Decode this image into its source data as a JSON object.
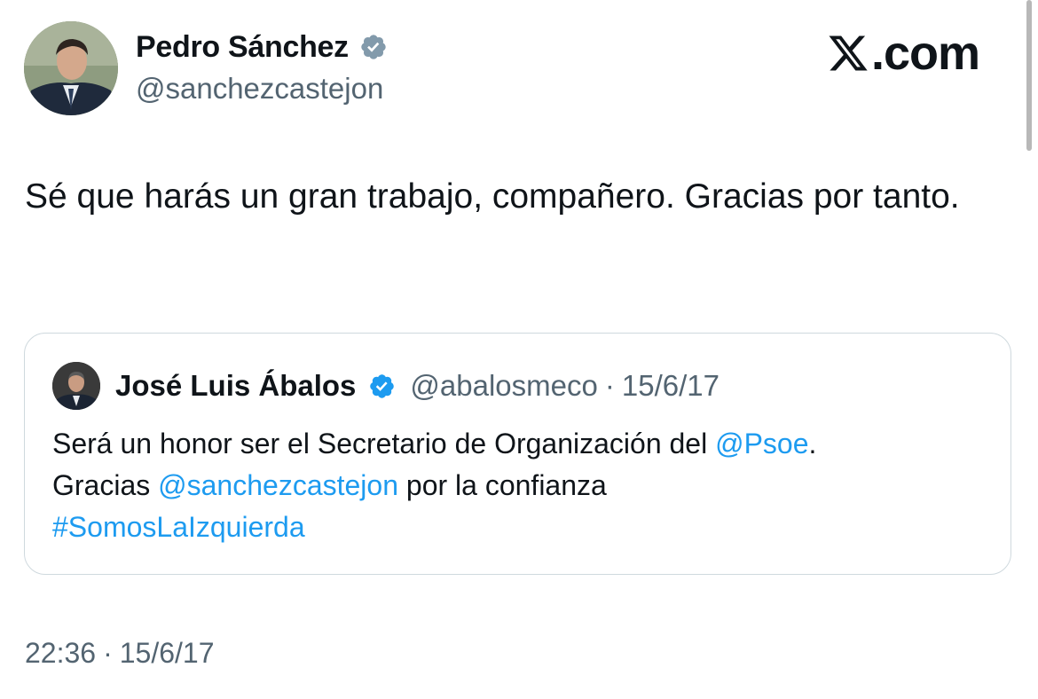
{
  "author": {
    "name": "Pedro Sánchez",
    "handle": "@sanchezcastejon"
  },
  "brand": {
    "text": ".com",
    "icon": "x-logo-icon"
  },
  "tweet": {
    "text": "Sé que harás un gran trabajo, compañero. Gracias por tanto."
  },
  "quoted": {
    "name": "José Luis Ábalos",
    "handle": "@abalosmeco",
    "separator": "·",
    "date": "15/6/17",
    "text_1": "Será un honor ser el Secretario de Organización del ",
    "mention_1": "@Psoe",
    "text_2": ".",
    "text_3": "Gracias ",
    "mention_2": "@sanchezcastejon",
    "text_4": " por la confianza",
    "hashtag": "#SomosLaIzquierda"
  },
  "timestamp": {
    "time": "22:36",
    "separator": "·",
    "date": "15/6/17"
  },
  "colors": {
    "link": "#1d9bf0",
    "verified_badge": "#1d9bf0",
    "author_badge": "#829aab",
    "secondary_text": "#536471"
  }
}
